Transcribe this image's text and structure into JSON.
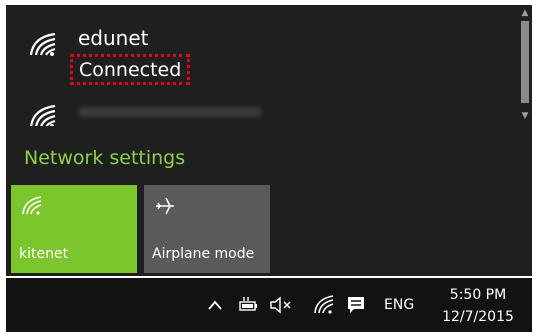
{
  "networks": [
    {
      "name": "edunet",
      "status": "Connected"
    },
    {
      "name": ""
    }
  ],
  "network_settings_label": "Network settings",
  "quick_actions": {
    "wifi": {
      "label": "kitenet",
      "active": true
    },
    "airplane": {
      "label": "Airplane mode",
      "active": false
    }
  },
  "taskbar": {
    "language": "ENG",
    "time": "5:50 PM",
    "date": "12/7/2015"
  },
  "colors": {
    "flyout_background": "#1f1f1f",
    "accent_green": "#7bc62c",
    "settings_link": "#8ed04a",
    "inactive_tile": "#5a5a5a",
    "highlight_box": "#e3001b",
    "taskbar_background": "#121212"
  },
  "icons": {
    "network": "wifi-icon",
    "airplane": "airplane-icon",
    "tray": [
      "chevron-up-icon",
      "battery-plug-icon",
      "volume-muted-icon",
      "wifi-icon",
      "action-center-icon"
    ]
  }
}
